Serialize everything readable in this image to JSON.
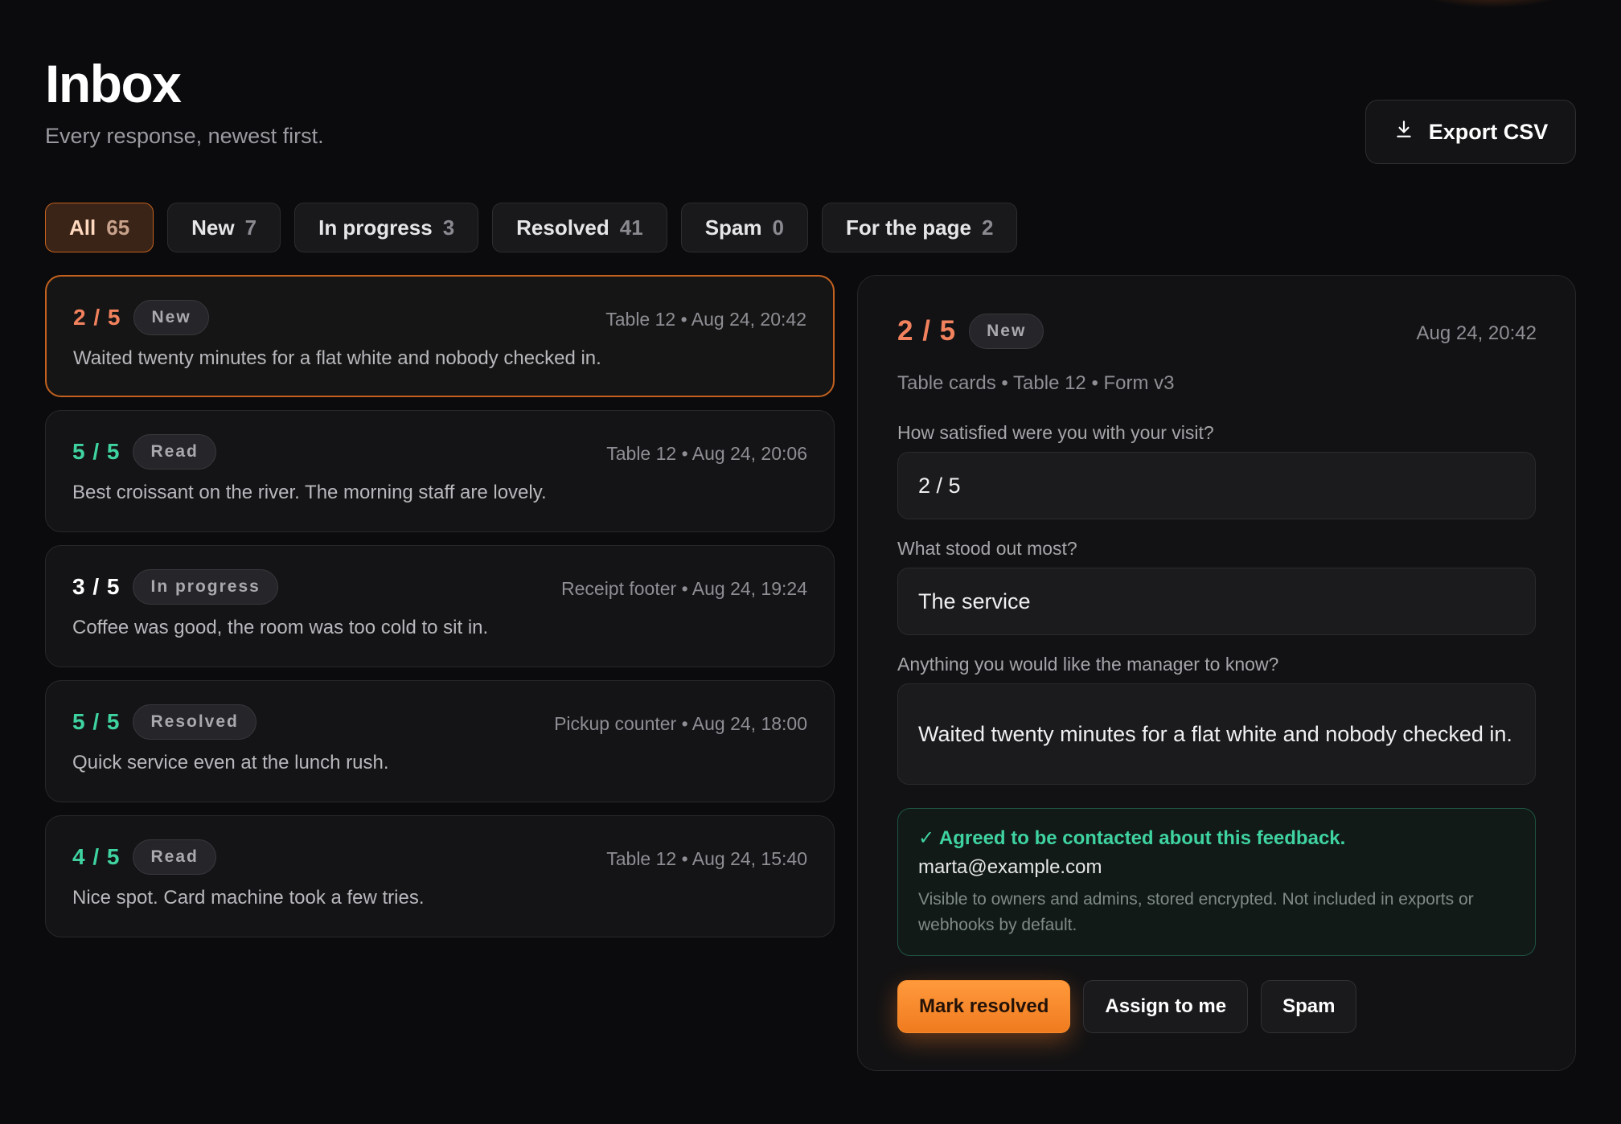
{
  "header": {
    "title": "Inbox",
    "subtitle": "Every response, newest first.",
    "export_label": "Export CSV"
  },
  "filters": [
    {
      "label": "All",
      "count": "65",
      "active": true
    },
    {
      "label": "New",
      "count": "7"
    },
    {
      "label": "In progress",
      "count": "3"
    },
    {
      "label": "Resolved",
      "count": "41"
    },
    {
      "label": "Spam",
      "count": "0"
    },
    {
      "label": "For the page",
      "count": "2"
    }
  ],
  "responses": [
    {
      "rating": "2 / 5",
      "status": "New",
      "meta": "Table 12 • Aug 24, 20:42",
      "text": "Waited twenty minutes for a flat white and nobody checked in."
    },
    {
      "rating": "5 / 5",
      "status": "Read",
      "meta": "Table 12 • Aug 24, 20:06",
      "text": "Best croissant on the river. The morning staff are lovely."
    },
    {
      "rating": "3 / 5",
      "status": "In progress",
      "meta": "Receipt footer • Aug 24, 19:24",
      "text": "Coffee was good, the room was too cold to sit in."
    },
    {
      "rating": "5 / 5",
      "status": "Resolved",
      "meta": "Pickup counter • Aug 24, 18:00",
      "text": "Quick service even at the lunch rush."
    },
    {
      "rating": "4 / 5",
      "status": "Read",
      "meta": "Table 12 • Aug 24, 15:40",
      "text": "Nice spot. Card machine took a few tries."
    }
  ],
  "detail": {
    "rating": "2 / 5",
    "status": "New",
    "time": "Aug 24, 20:42",
    "source": "Table cards • Table 12 • Form v3",
    "questions": [
      {
        "q": "How satisfied were you with your visit?",
        "a": "2 / 5"
      },
      {
        "q": "What stood out most?",
        "a": "The service"
      },
      {
        "q": "Anything you would like the manager to know?",
        "a": "Waited twenty minutes for a flat white and nobody checked in."
      }
    ],
    "consent": {
      "title": "✓ Agreed to be contacted about this feedback.",
      "email": "marta@example.com",
      "note": "Visible to owners and admins, stored encrypted. Not included in exports or webhooks by default."
    },
    "actions": {
      "resolve": "Mark resolved",
      "assign": "Assign to me",
      "spam": "Spam"
    }
  },
  "colors": {
    "accent": "#f07b1f",
    "low_rating": "#f2825d",
    "high_rating": "#3fd3a0"
  }
}
